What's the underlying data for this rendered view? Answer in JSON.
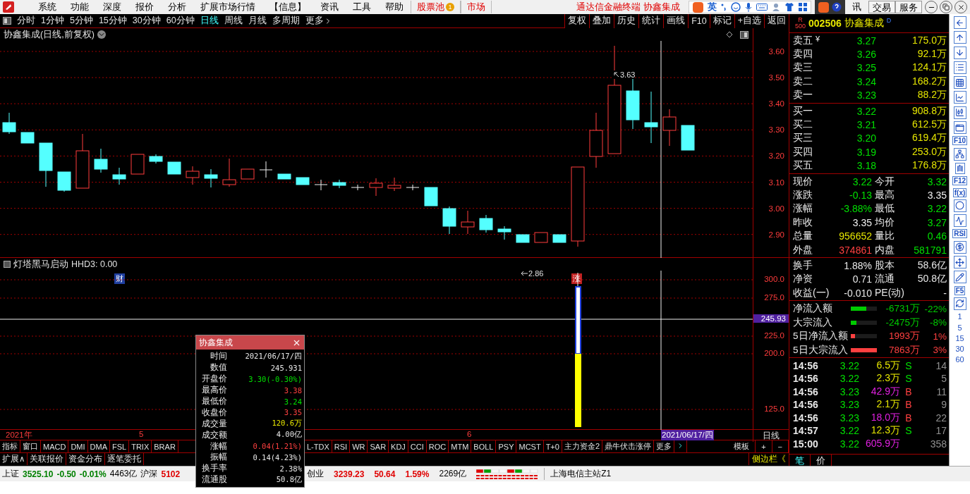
{
  "menubar": {
    "items": [
      "系统",
      "功能",
      "深度",
      "报价",
      "分析",
      "扩展市场行情",
      "【信息】",
      "资讯",
      "工具",
      "帮助"
    ],
    "stock_pool": "股票池",
    "stock_pool_badge": "1",
    "market": "市场",
    "title": "通达信金融终端 协鑫集成",
    "ime_mode": "英",
    "partial_item": "讯",
    "right_buttons": [
      "交易",
      "服务"
    ]
  },
  "periods": [
    {
      "label": "分时",
      "selected": false
    },
    {
      "label": "1分钟",
      "selected": false
    },
    {
      "label": "5分钟",
      "selected": false
    },
    {
      "label": "15分钟",
      "selected": false
    },
    {
      "label": "30分钟",
      "selected": false
    },
    {
      "label": "60分钟",
      "selected": false
    },
    {
      "label": "日线",
      "selected": true
    },
    {
      "label": "周线",
      "selected": false
    },
    {
      "label": "月线",
      "selected": false
    },
    {
      "label": "多周期",
      "selected": false
    },
    {
      "label": "更多",
      "selected": false
    }
  ],
  "chart_buttons": [
    "复权",
    "叠加",
    "历史",
    "统计",
    "画线",
    "F10",
    "标记",
    "+自选",
    "返回"
  ],
  "quote_header": {
    "r_label": "R",
    "r_value": "500",
    "code": "002506",
    "name": "协鑫集成",
    "flag": "D"
  },
  "chart": {
    "title": "协鑫集成(日线,前复权)",
    "yticks": [
      "3.60",
      "3.50",
      "3.40",
      "3.30",
      "3.20",
      "3.10",
      "3.00",
      "2.90"
    ],
    "high_label": "3.63",
    "low_label": "2.86",
    "event_badges": [
      {
        "text": "财",
        "kind": "finance"
      },
      {
        "text": "涨",
        "kind": "limit"
      }
    ]
  },
  "indicator": {
    "name": "灯塔黑马启动",
    "series": "HHD3: 0.00",
    "yticks": [
      "300.0",
      "275.0",
      "225.0",
      "200.0",
      "125.0"
    ],
    "cursor_value": "245.93"
  },
  "time_axis": {
    "year": "2021年",
    "months": [
      "5",
      "6"
    ],
    "cursor_date": "2021/06/17/四",
    "period": "日线"
  },
  "indicator_tabs_left": [
    "指标",
    "窗口",
    "MACD",
    "DMI",
    "DMA",
    "FSL",
    "TRIX",
    "BRAR"
  ],
  "indicator_tabs_right": [
    "L-TDX",
    "RSI",
    "WR",
    "SAR",
    "KDJ",
    "CCI",
    "ROC",
    "MTM",
    "BOLL",
    "PSY",
    "MCST",
    "T+0",
    "主力资金2",
    "鼎牛伏击涨停",
    "更多"
  ],
  "indicator_tools": [
    "模板",
    "+",
    "−"
  ],
  "bottom_tabs": [
    "扩展∧",
    "关联报价",
    "资金分布",
    "逐笔委托"
  ],
  "sidebar_toggle": "侧边栏《",
  "popup": {
    "title": "协鑫集成",
    "rows": [
      {
        "label": "时间",
        "value": "2021/06/17/四",
        "color": "#e8e8e8"
      },
      {
        "label": "数值",
        "value": "245.931",
        "color": "#e8e8e8"
      },
      {
        "label": "开盘价",
        "value": "3.30(-0.30%)",
        "color": "#00e000"
      },
      {
        "label": "最高价",
        "value": "3.38",
        "color": "#ff4040"
      },
      {
        "label": "最低价",
        "value": "3.24",
        "color": "#00e000"
      },
      {
        "label": "收盘价",
        "value": "3.35",
        "color": "#ff4040"
      },
      {
        "label": "成交量",
        "value": "120.6万",
        "color": "#e6e600"
      },
      {
        "label": "成交额",
        "value": "4.00亿",
        "color": "#e8e8e8"
      },
      {
        "label": "涨幅",
        "value": "0.04(1.21%)",
        "color": "#ff4040"
      },
      {
        "label": "振幅",
        "value": "0.14(4.23%)",
        "color": "#e8e8e8"
      },
      {
        "label": "换手率",
        "value": "2.38%",
        "color": "#e8e8e8"
      },
      {
        "label": "流通股",
        "value": "50.8亿",
        "color": "#e8e8e8"
      }
    ]
  },
  "order_book": {
    "currency": "¥",
    "sells": [
      {
        "label": "卖五",
        "price": "3.27",
        "volume": "175.0万"
      },
      {
        "label": "卖四",
        "price": "3.26",
        "volume": "92.1万"
      },
      {
        "label": "卖三",
        "price": "3.25",
        "volume": "124.1万"
      },
      {
        "label": "卖二",
        "price": "3.24",
        "volume": "168.2万"
      },
      {
        "label": "卖一",
        "price": "3.23",
        "volume": "88.2万"
      }
    ],
    "buys": [
      {
        "label": "买一",
        "price": "3.22",
        "volume": "908.8万"
      },
      {
        "label": "买二",
        "price": "3.21",
        "volume": "612.5万"
      },
      {
        "label": "买三",
        "price": "3.20",
        "volume": "619.4万"
      },
      {
        "label": "买四",
        "price": "3.19",
        "volume": "253.0万"
      },
      {
        "label": "买五",
        "price": "3.18",
        "volume": "176.8万"
      }
    ]
  },
  "stats": [
    {
      "label": "现价",
      "value": "3.22",
      "color": "#00e000"
    },
    {
      "label": "今开",
      "value": "3.32",
      "color": "#00e000"
    },
    {
      "label": "涨跌",
      "value": "-0.13",
      "color": "#00e000"
    },
    {
      "label": "最高",
      "value": "3.35",
      "color": "#f0f0f0"
    },
    {
      "label": "涨幅",
      "value": "-3.88%",
      "color": "#00e000"
    },
    {
      "label": "最低",
      "value": "3.22",
      "color": "#00e000"
    },
    {
      "label": "昨收",
      "value": "3.35",
      "color": "#f0f0f0"
    },
    {
      "label": "均价",
      "value": "3.27",
      "color": "#00e000"
    },
    {
      "label": "总量",
      "value": "956652",
      "color": "#e6e600"
    },
    {
      "label": "量比",
      "value": "0.46",
      "color": "#00e000"
    },
    {
      "label": "外盘",
      "value": "374861",
      "color": "#ff4040"
    },
    {
      "label": "内盘",
      "value": "581791",
      "color": "#00e000"
    }
  ],
  "fundamentals": [
    {
      "label": "换手",
      "value": "1.88%",
      "label2": "股本",
      "value2": "58.6亿"
    },
    {
      "label": "净资",
      "value": "0.71",
      "label2": "流通",
      "value2": "50.8亿"
    },
    {
      "label": "收益(一)",
      "value": "-0.010",
      "label2": "PE(动)",
      "value2": "-"
    }
  ],
  "flows": [
    {
      "label": "净流入额",
      "amount": "-6731万",
      "pct": "-22%",
      "level": 0.6,
      "color": "#00cc00"
    },
    {
      "label": "大宗流入",
      "amount": "-2475万",
      "pct": "-8%",
      "level": 0.22,
      "color": "#00cc00"
    },
    {
      "label": "5日净流入额",
      "amount": "1993万",
      "pct": "1%",
      "level": 0.17,
      "color": "#ff4040"
    },
    {
      "label": "5日大宗流入",
      "amount": "7863万",
      "pct": "3%",
      "level": 1,
      "color": "#ff4040"
    }
  ],
  "ticks": [
    {
      "time": "14:56",
      "price": "3.22",
      "volume": "6.5万",
      "big": false,
      "side": "S",
      "kind": "sell",
      "count": "14"
    },
    {
      "time": "14:56",
      "price": "3.22",
      "volume": "2.3万",
      "big": false,
      "side": "S",
      "kind": "sell",
      "count": "5"
    },
    {
      "time": "14:56",
      "price": "3.23",
      "volume": "42.9万",
      "big": true,
      "side": "B",
      "kind": "buy",
      "count": "11"
    },
    {
      "time": "14:56",
      "price": "3.23",
      "volume": "2.1万",
      "big": false,
      "side": "B",
      "kind": "buy",
      "count": "9"
    },
    {
      "time": "14:56",
      "price": "3.23",
      "volume": "18.0万",
      "big": true,
      "side": "B",
      "kind": "buy",
      "count": "22"
    },
    {
      "time": "14:57",
      "price": "3.22",
      "volume": "12.3万",
      "big": false,
      "side": "S",
      "kind": "sell",
      "count": "17"
    },
    {
      "time": "15:00",
      "price": "3.22",
      "volume": "605.9万",
      "big": true,
      "count": "358"
    }
  ],
  "panel_tabs": [
    "笔",
    "价"
  ],
  "sidebar": [
    {
      "kind": "icon"
    },
    {
      "kind": "icon"
    },
    {
      "kind": "icon"
    },
    {
      "kind": "icon"
    },
    {
      "kind": "icon"
    },
    {
      "kind": "icon"
    },
    {
      "kind": "icon"
    },
    {
      "kind": "icon"
    },
    {
      "kind": "label",
      "text": "F10"
    },
    {
      "kind": "icon"
    },
    {
      "kind": "label",
      "text": "自"
    },
    {
      "kind": "label",
      "text": "F12"
    },
    {
      "kind": "label",
      "text": "f(x)"
    },
    {
      "kind": "icon"
    },
    {
      "kind": "icon"
    },
    {
      "kind": "label",
      "text": "RSI"
    },
    {
      "kind": "icon"
    },
    {
      "kind": "icon"
    },
    {
      "kind": "icon"
    },
    {
      "kind": "label",
      "text": "F5"
    },
    {
      "kind": "icon"
    },
    {
      "kind": "number",
      "text": "1"
    },
    {
      "kind": "number",
      "text": "5"
    },
    {
      "kind": "number",
      "text": "15"
    },
    {
      "kind": "number",
      "text": "30"
    },
    {
      "kind": "number",
      "text": "60"
    }
  ],
  "status": {
    "indices": [
      {
        "name": "上证",
        "value": "3525.10",
        "change": "-0.50",
        "pct": "-0.01%",
        "amount": "4463亿",
        "color": "#008000"
      },
      {
        "name": "沪深",
        "value": "5102",
        "color": "#e00000"
      }
    ],
    "indices2": [
      {
        "name": "创业",
        "value": "3239.23",
        "change": "50.64",
        "pct": "1.59%",
        "amount": "2269亿",
        "color": "#e00000"
      }
    ],
    "server": "上海电信主站Z1"
  }
}
